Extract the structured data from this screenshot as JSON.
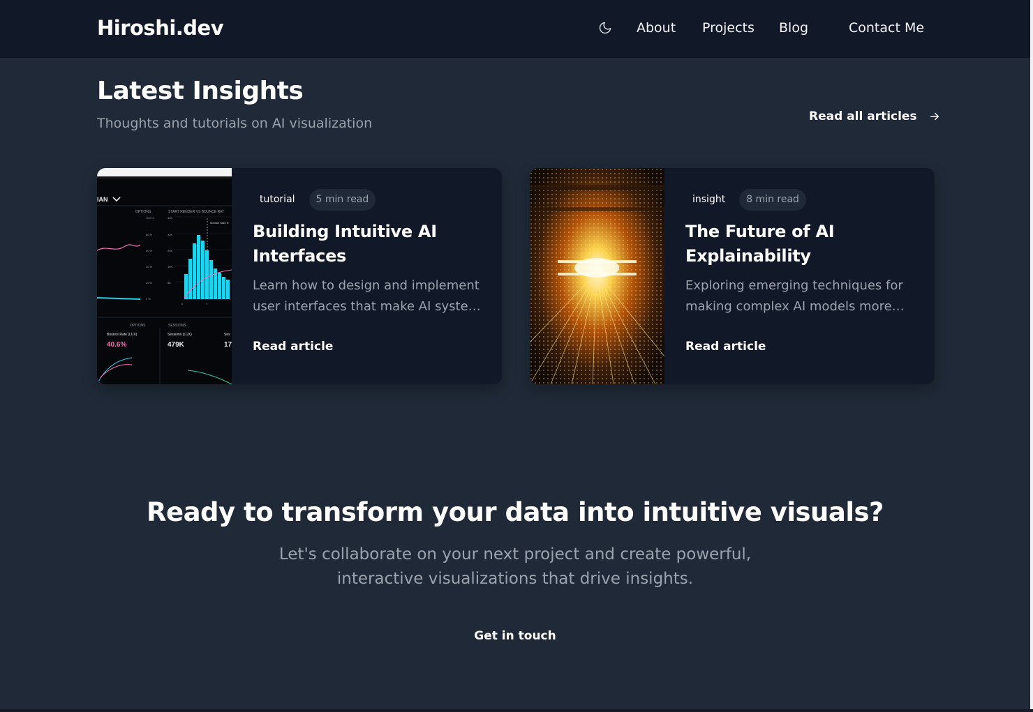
{
  "header": {
    "logo": "Hiroshi.dev",
    "theme_toggle_icon": "moon-icon",
    "nav": [
      {
        "label": "About"
      },
      {
        "label": "Projects"
      },
      {
        "label": "Blog"
      },
      {
        "label": "Contact Me"
      }
    ]
  },
  "insights": {
    "title": "Latest Insights",
    "subtitle": "Thoughts and tutorials on AI visualization",
    "read_all_label": "Read all articles",
    "read_all_icon": "arrow-right-icon"
  },
  "articles": [
    {
      "category": "tutorial",
      "read_time": "5 min read",
      "title": "Building Intuitive AI Interfaces",
      "excerpt": "Learn how to design and implement user interfaces that make AI systems accessible and understandable.",
      "link_label": "Read article",
      "image_alt": "analytics-dashboard-image",
      "image_labels": {
        "dropdown": "IAN",
        "options_1": "OPTIONS",
        "chart_heading": "START RENDER VS BOUNCE RAT",
        "median": "Median Start R",
        "options_2": "OPTIONS",
        "sessions": "SESSIONS",
        "bounce_label": "Bounce Rate (LUX)",
        "bounce_value": "40.6%",
        "sessions_label": "Sessions (LUX)",
        "sessions_value": "479K",
        "partial_label": "Ses",
        "partial_value": "17"
      }
    },
    {
      "category": "insight",
      "read_time": "8 min read",
      "title": "The Future of AI Explainability",
      "excerpt": "Exploring emerging techniques for making complex AI models more transparent and interpretable.",
      "link_label": "Read article",
      "image_alt": "light-tunnel-image"
    }
  ],
  "cta": {
    "title": "Ready to transform your data into intuitive visuals?",
    "text": "Let's collaborate on your next project and create powerful, interactive visualizations that drive insights.",
    "button_label": "Get in touch"
  },
  "colors": {
    "page_bg": "#1f2937",
    "header_bg": "#111827",
    "card_bg": "#111827",
    "muted_text": "#9ca3af",
    "chart_accent": "#22d3ee",
    "chart_pink": "#f472b6"
  }
}
